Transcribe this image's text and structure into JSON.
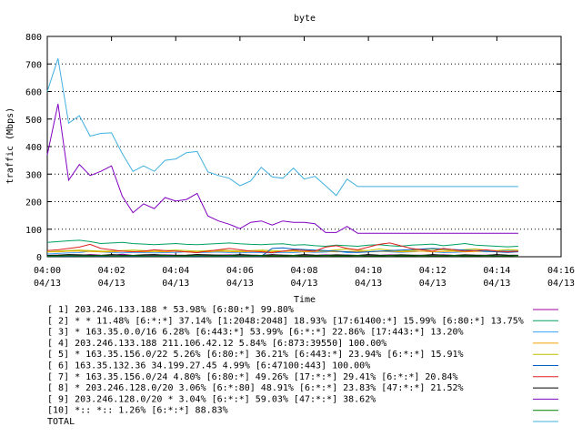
{
  "chart_data": {
    "type": "line",
    "title": "byte",
    "xlabel": "Time",
    "ylabel": "traffic (Mbps)",
    "ylim": [
      0,
      800
    ],
    "y_ticks": [
      "0",
      "100",
      "200",
      "300",
      "400",
      "500",
      "600",
      "700",
      "800"
    ],
    "x_ticks": [
      {
        "time": "04:00",
        "date": "04/13"
      },
      {
        "time": "04:02",
        "date": "04/13"
      },
      {
        "time": "04:04",
        "date": "04/13"
      },
      {
        "time": "04:06",
        "date": "04/13"
      },
      {
        "time": "04:08",
        "date": "04/13"
      },
      {
        "time": "04:10",
        "date": "04/13"
      },
      {
        "time": "04:12",
        "date": "04/13"
      },
      {
        "time": "04:14",
        "date": "04/13"
      },
      {
        "time": "04:16",
        "date": "04/13"
      }
    ],
    "x": [
      "04:00:00",
      "04:00:20",
      "04:00:40",
      "04:01:00",
      "04:01:20",
      "04:01:40",
      "04:02:00",
      "04:02:20",
      "04:02:40",
      "04:03:00",
      "04:03:20",
      "04:03:40",
      "04:04:00",
      "04:04:20",
      "04:04:40",
      "04:05:00",
      "04:05:20",
      "04:05:40",
      "04:06:00",
      "04:06:20",
      "04:06:40",
      "04:07:00",
      "04:07:20",
      "04:07:40",
      "04:08:00",
      "04:08:20",
      "04:08:40",
      "04:09:00",
      "04:09:20",
      "04:09:40",
      "04:10:00",
      "04:10:20",
      "04:10:40",
      "04:11:00",
      "04:11:20",
      "04:11:40",
      "04:12:00",
      "04:12:20",
      "04:12:40",
      "04:13:00",
      "04:13:20",
      "04:13:40",
      "04:14:00",
      "04:14:20",
      "04:14:40"
    ],
    "series": [
      {
        "name": "[ 1] 203.246.133.188 * 53.98%  [6:80:*] 99.80%",
        "color": "#a000a0",
        "values": [
          5,
          6,
          5,
          5,
          8,
          6,
          5,
          9,
          5,
          6,
          5,
          7,
          6,
          5,
          8,
          5,
          6,
          7,
          5,
          6,
          5,
          8,
          6,
          5,
          6,
          5,
          7,
          5,
          6,
          5,
          6,
          5,
          7,
          6,
          5,
          6,
          5,
          7,
          5,
          6,
          5,
          6,
          7,
          5,
          6
        ]
      },
      {
        "name": "[ 2] * * 11.48%  [6:*:*] 37.14% [1:2048:2048] 18.93% [17:61400:*] 15.99% [6:80:*] 13.75%",
        "color": "#00a060",
        "values": [
          52,
          55,
          58,
          60,
          55,
          48,
          50,
          52,
          48,
          46,
          44,
          46,
          48,
          45,
          44,
          46,
          48,
          50,
          47,
          45,
          44,
          46,
          47,
          42,
          44,
          40,
          38,
          42,
          40,
          38,
          42,
          44,
          40,
          38,
          42,
          44,
          46,
          40,
          44,
          48,
          42,
          40,
          38,
          36,
          38
        ]
      },
      {
        "name": "[ 3] * 163.35.0.0/16 6.28%  [6:443:*] 53.99% [6:*:*] 22.86% [17:443:*] 13.20%",
        "color": "#40a0ff",
        "values": [
          10,
          12,
          14,
          15,
          20,
          18,
          15,
          14,
          16,
          15,
          14,
          15,
          16,
          18,
          15,
          16,
          17,
          15,
          14,
          16,
          15,
          14,
          16,
          15,
          18,
          16,
          17,
          20,
          15,
          16,
          18,
          20,
          18,
          16,
          18,
          20,
          18,
          15,
          16,
          18,
          20,
          18,
          20,
          22,
          20
        ]
      },
      {
        "name": "[ 4] 203.246.133.188 211.106.42.12 5.84%  [6:873:39550] 100.00%",
        "color": "#f0a000",
        "values": [
          18,
          18,
          20,
          20,
          19,
          18,
          18,
          20,
          19,
          18,
          19,
          18,
          20,
          18,
          19,
          18,
          20,
          19,
          18,
          19,
          20,
          18,
          19,
          20,
          18,
          19,
          20,
          18,
          19,
          20,
          18,
          19,
          20,
          18,
          19,
          20,
          18,
          19,
          20,
          18,
          19,
          20,
          18,
          19,
          20
        ]
      },
      {
        "name": "[ 5] * 163.35.156.0/22 5.26%  [6:80:*] 36.21% [6:443:*] 23.94% [6:*:*] 15.91%",
        "color": "#c0c000",
        "values": [
          18,
          20,
          22,
          24,
          22,
          20,
          20,
          22,
          24,
          22,
          20,
          22,
          24,
          22,
          20,
          22,
          24,
          22,
          20,
          22,
          24,
          22,
          20,
          22,
          24,
          22,
          20,
          25,
          28,
          24,
          22,
          28,
          24,
          20,
          22,
          26,
          28,
          24,
          22,
          26,
          28,
          24,
          22,
          26,
          24
        ]
      },
      {
        "name": "[ 6] 163.35.132.36 34.199.27.45 4.99%  [6:47100:443] 100.00%",
        "color": "#0060c0",
        "values": [
          2,
          2,
          2,
          2,
          2,
          2,
          2,
          2,
          2,
          2,
          2,
          2,
          2,
          2,
          2,
          2,
          2,
          2,
          2,
          2,
          2,
          30,
          32,
          28,
          26,
          24,
          22,
          20,
          18,
          16,
          18,
          20,
          22,
          24,
          26,
          28,
          30,
          28,
          26,
          24,
          22,
          20,
          18,
          16,
          18
        ]
      },
      {
        "name": "[ 7] * 163.35.156.0/24 4.80%  [6:80:*] 49.26% [17:*:*] 29.41% [6:*:*] 20.84%",
        "color": "#e02020",
        "values": [
          22,
          25,
          30,
          35,
          45,
          30,
          25,
          20,
          18,
          20,
          25,
          22,
          20,
          18,
          15,
          20,
          25,
          30,
          25,
          20,
          18,
          15,
          20,
          25,
          22,
          20,
          35,
          40,
          30,
          25,
          35,
          45,
          50,
          40,
          30,
          25,
          20,
          30,
          25,
          20,
          22,
          25,
          20,
          18,
          20
        ]
      },
      {
        "name": "[ 8] * 203.246.128.0/20 3.06%  [6:*:80] 48.91% [6:*:*] 23.83% [47:*:*] 21.52%",
        "color": "#000000",
        "values": [
          5,
          6,
          8,
          7,
          6,
          5,
          8,
          6,
          5,
          7,
          8,
          6,
          5,
          6,
          8,
          7,
          6,
          5,
          8,
          6,
          5,
          7,
          6,
          5,
          8,
          6,
          5,
          7,
          6,
          5,
          8,
          6,
          5,
          7,
          6,
          5,
          8,
          6,
          5,
          7,
          6,
          5,
          8,
          6,
          5
        ]
      },
      {
        "name": "[ 9] 203.246.128.0/20 * 3.04%  [6:*:*] 59.03% [47:*:*] 38.62%",
        "color": "#8000c0",
        "values": [
          370,
          555,
          278,
          335,
          295,
          310,
          330,
          220,
          160,
          192,
          175,
          215,
          202,
          208,
          230,
          148,
          130,
          118,
          102,
          125,
          130,
          115,
          130,
          125,
          125,
          120,
          88,
          88,
          110,
          85,
          85,
          85,
          85,
          85,
          85,
          85,
          85,
          85,
          85,
          85,
          85,
          85,
          85,
          85,
          85
        ]
      },
      {
        "name": "[10] *:: *:: 1.26%  [6:*:*] 88.83%",
        "color": "#008000",
        "values": [
          3,
          3,
          4,
          3,
          3,
          4,
          3,
          3,
          4,
          3,
          3,
          4,
          3,
          3,
          4,
          3,
          3,
          4,
          3,
          3,
          4,
          3,
          3,
          4,
          3,
          3,
          4,
          3,
          3,
          4,
          3,
          3,
          4,
          3,
          3,
          4,
          3,
          3,
          4,
          3,
          3,
          4,
          3,
          3,
          4
        ]
      },
      {
        "name": "TOTAL",
        "color": "#40b0e0",
        "values": [
          600,
          720,
          485,
          512,
          438,
          448,
          450,
          375,
          310,
          330,
          310,
          350,
          355,
          378,
          382,
          308,
          295,
          285,
          258,
          275,
          325,
          290,
          285,
          322,
          282,
          292,
          258,
          222,
          282,
          255,
          255,
          255,
          255,
          255,
          255,
          255,
          255,
          255,
          255,
          255,
          255,
          255,
          255,
          255,
          255
        ]
      }
    ]
  }
}
